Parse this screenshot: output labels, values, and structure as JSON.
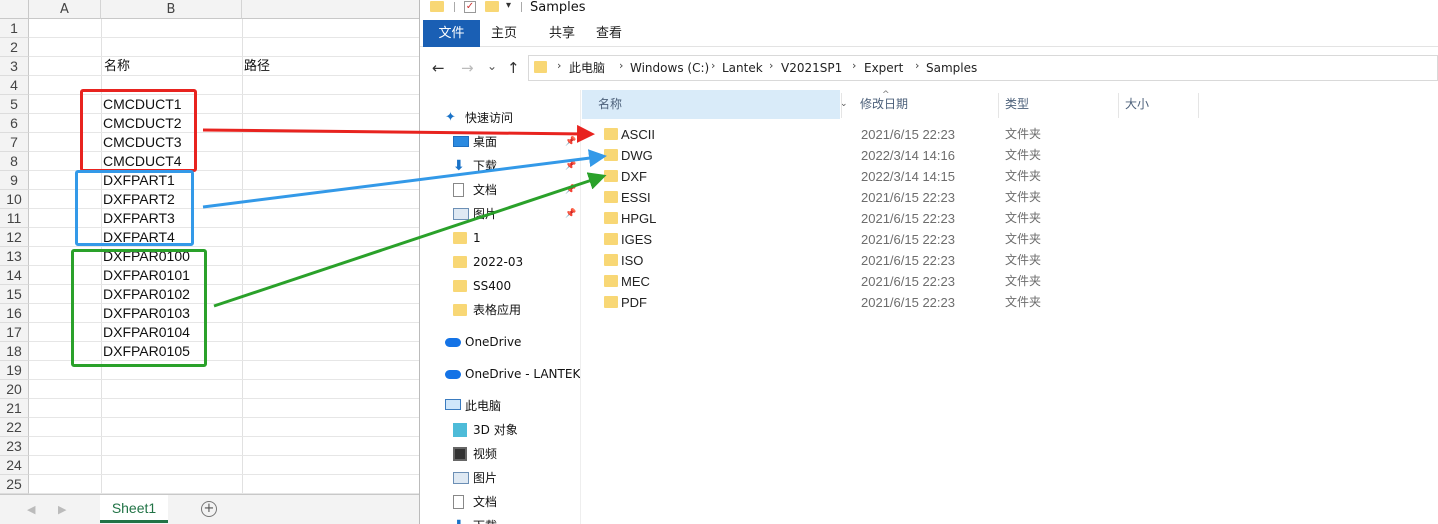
{
  "excel": {
    "columns": [
      "A",
      "B"
    ],
    "rows": [
      "1",
      "2",
      "3",
      "4",
      "5",
      "6",
      "7",
      "8",
      "9",
      "10",
      "11",
      "12",
      "13",
      "14",
      "15",
      "16",
      "17",
      "18",
      "19",
      "20",
      "21",
      "22",
      "23",
      "24",
      "25"
    ],
    "header_name": "名称",
    "header_path": "路径",
    "names": [
      "CMCDUCT1",
      "CMCDUCT2",
      "CMCDUCT3",
      "CMCDUCT4",
      "DXFPART1",
      "DXFPART2",
      "DXFPART3",
      "DXFPART4",
      "DXFPAR0100",
      "DXFPAR0101",
      "DXFPAR0102",
      "DXFPAR0103",
      "DXFPAR0104",
      "DXFPAR0105"
    ],
    "sheet_tab": "Sheet1",
    "add_sheet": "+",
    "box_colors": {
      "red": "#e8231f",
      "blue": "#3399e8",
      "green": "#2aa12a"
    }
  },
  "explorer": {
    "window_title": "Samples",
    "ribbon_tabs": [
      "文件",
      "主页",
      "共享",
      "查看"
    ],
    "nav_buttons": {
      "back": "←",
      "forward": "→",
      "recent": "⌄",
      "up": "↑"
    },
    "breadcrumb": [
      "此电脑",
      "Windows (C:)",
      "Lantek",
      "V2021SP1",
      "Expert",
      "Samples"
    ],
    "nav_pane": [
      {
        "label": "快速访问",
        "icon": "star-icon"
      },
      {
        "label": "桌面",
        "icon": "desktop-icon",
        "pinned": true
      },
      {
        "label": "下载",
        "icon": "download-icon",
        "pinned": true
      },
      {
        "label": "文档",
        "icon": "document-icon",
        "pinned": true
      },
      {
        "label": "图片",
        "icon": "picture-icon",
        "pinned": true
      },
      {
        "label": "1",
        "icon": "folder-icon"
      },
      {
        "label": "2022-03",
        "icon": "folder-icon"
      },
      {
        "label": "SS400",
        "icon": "folder-icon"
      },
      {
        "label": "表格应用",
        "icon": "folder-icon"
      },
      {
        "label": "OneDrive",
        "icon": "cloud-icon"
      },
      {
        "label": "OneDrive - LANTEK",
        "icon": "cloud-icon"
      },
      {
        "label": "此电脑",
        "icon": "pc-icon"
      },
      {
        "label": "3D 对象",
        "icon": "cube-icon"
      },
      {
        "label": "视频",
        "icon": "video-icon"
      },
      {
        "label": "图片",
        "icon": "picture-icon"
      },
      {
        "label": "文档",
        "icon": "document-icon"
      },
      {
        "label": "下载",
        "icon": "download-icon"
      }
    ],
    "columns": [
      "名称",
      "修改日期",
      "类型",
      "大小"
    ],
    "files": [
      {
        "name": "ASCII",
        "date": "2021/6/15 22:23",
        "type": "文件夹"
      },
      {
        "name": "DWG",
        "date": "2022/3/14 14:16",
        "type": "文件夹"
      },
      {
        "name": "DXF",
        "date": "2022/3/14 14:15",
        "type": "文件夹"
      },
      {
        "name": "ESSI",
        "date": "2021/6/15 22:23",
        "type": "文件夹"
      },
      {
        "name": "HPGL",
        "date": "2021/6/15 22:23",
        "type": "文件夹"
      },
      {
        "name": "IGES",
        "date": "2021/6/15 22:23",
        "type": "文件夹"
      },
      {
        "name": "ISO",
        "date": "2021/6/15 22:23",
        "type": "文件夹"
      },
      {
        "name": "MEC",
        "date": "2021/6/15 22:23",
        "type": "文件夹"
      },
      {
        "name": "PDF",
        "date": "2021/6/15 22:23",
        "type": "文件夹"
      }
    ]
  }
}
